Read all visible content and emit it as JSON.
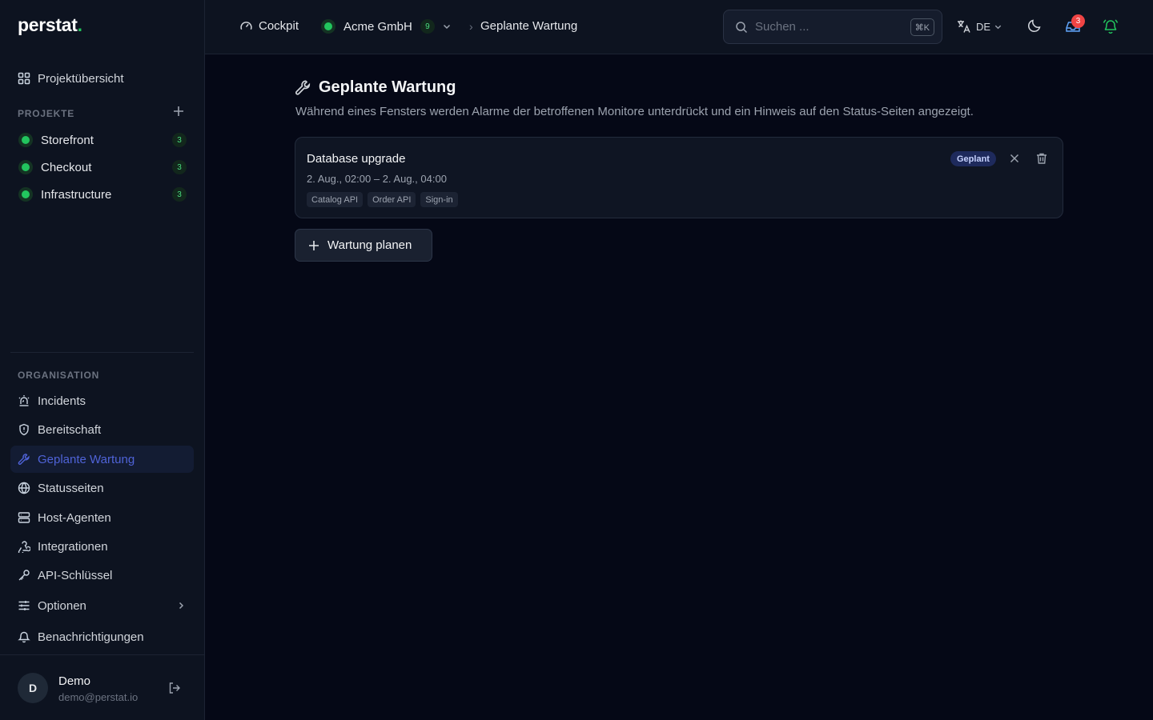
{
  "brand": {
    "name": "perstat",
    "dot": "."
  },
  "sidebar": {
    "overview_label": "Projektübersicht",
    "projects_section": "PROJEKTE",
    "projects": [
      {
        "name": "Storefront",
        "count": "3"
      },
      {
        "name": "Checkout",
        "count": "3"
      },
      {
        "name": "Infrastructure",
        "count": "3"
      }
    ],
    "org_section": "ORGANISATION",
    "items": [
      {
        "label": "Incidents",
        "icon": "siren-icon"
      },
      {
        "label": "Bereitschaft",
        "icon": "shield-icon"
      },
      {
        "label": "Geplante Wartung",
        "icon": "wrench-icon",
        "active": true
      },
      {
        "label": "Statusseiten",
        "icon": "globe-icon"
      },
      {
        "label": "Host-Agenten",
        "icon": "server-icon"
      },
      {
        "label": "Integrationen",
        "icon": "webhook-icon"
      },
      {
        "label": "API-Schlüssel",
        "icon": "key-icon"
      },
      {
        "label": "Optionen",
        "icon": "sliders-icon"
      },
      {
        "label": "Benachrichtigungen",
        "icon": "bell-icon"
      }
    ],
    "user": {
      "initial": "D",
      "name": "Demo",
      "email": "demo@perstat.io"
    }
  },
  "topbar": {
    "cockpit_label": "Cockpit",
    "org_name": "Acme GmbH",
    "org_count": "9",
    "current_page": "Geplante Wartung",
    "search_placeholder": "Suchen ...",
    "search_shortcut": "⌘K",
    "language": "DE",
    "notification_count": "3"
  },
  "main": {
    "title": "Geplante Wartung",
    "description": "Während eines Fensters werden Alarme der betroffenen Monitore unterdrückt und ein Hinweis auf den Status-Seiten angezeigt.",
    "windows": [
      {
        "title": "Database upgrade",
        "time": "2. Aug., 02:00 – 2. Aug., 04:00",
        "status": "Geplant",
        "tags": [
          "Catalog API",
          "Order API",
          "Sign-in"
        ]
      }
    ],
    "add_button_label": "Wartung planen"
  },
  "colors": {
    "background": "#050816",
    "sidebar": "#0d1320",
    "accent": "#4f63d8",
    "status_green": "#22c55e",
    "alert_red": "#ef4444"
  }
}
